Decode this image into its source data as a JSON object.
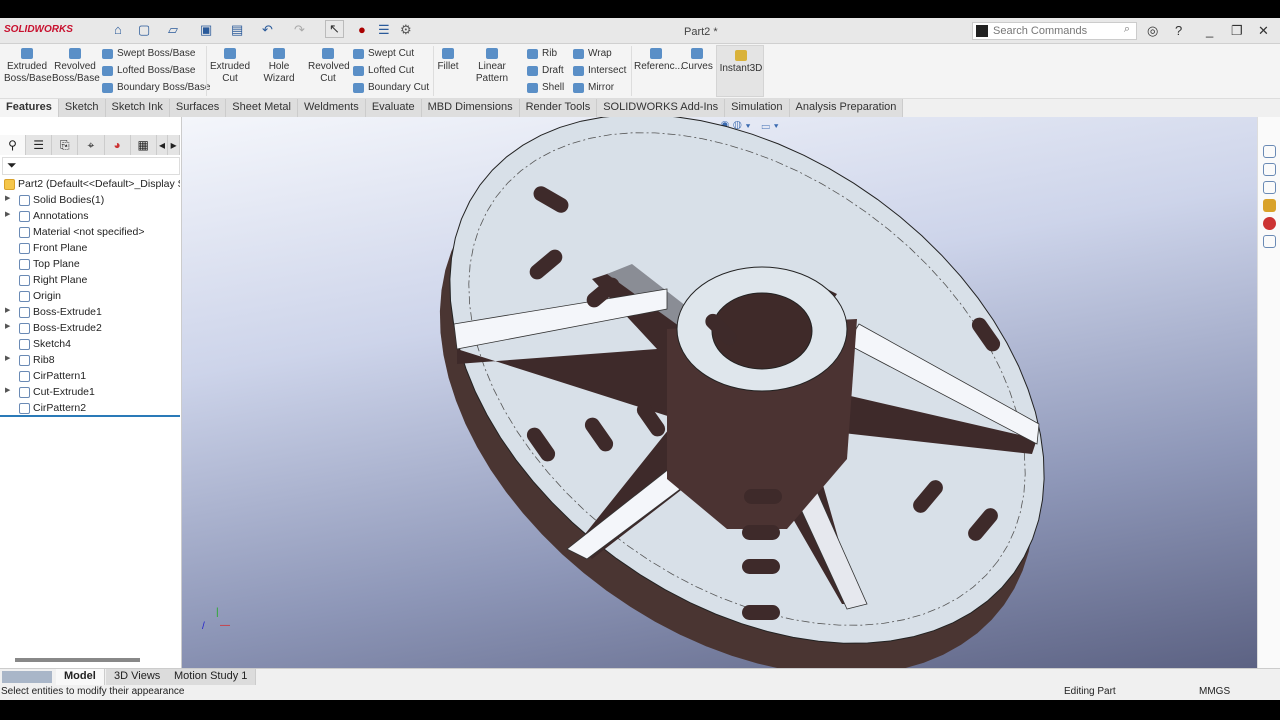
{
  "app": {
    "name": "SOLIDWORKS",
    "document_title": "Part2 *"
  },
  "search": {
    "placeholder": "Search Commands"
  },
  "ribbon": {
    "extruded_boss": "Extruded Boss/Base",
    "revolved_boss": "Revolved Boss/Base",
    "swept_boss": "Swept Boss/Base",
    "lofted_boss": "Lofted Boss/Base",
    "boundary_boss": "Boundary Boss/Base",
    "extruded_cut": "Extruded Cut",
    "hole_wizard": "Hole Wizard",
    "revolved_cut": "Revolved Cut",
    "swept_cut": "Swept Cut",
    "lofted_cut": "Lofted Cut",
    "boundary_cut": "Boundary Cut",
    "fillet": "Fillet",
    "linear_pattern": "Linear Pattern",
    "rib": "Rib",
    "draft": "Draft",
    "shell": "Shell",
    "wrap": "Wrap",
    "intersect": "Intersect",
    "mirror": "Mirror",
    "reference": "Referenc...",
    "curves": "Curves",
    "instant3d": "Instant3D"
  },
  "tabs": [
    "Features",
    "Sketch",
    "Sketch Ink",
    "Surfaces",
    "Sheet Metal",
    "Weldments",
    "Evaluate",
    "MBD Dimensions",
    "Render Tools",
    "SOLIDWORKS Add-Ins",
    "Simulation",
    "Analysis Preparation"
  ],
  "tree": {
    "root": "Part2  (Default<<Default>_Display S",
    "items": [
      {
        "label": "Solid Bodies(1)",
        "expandable": true
      },
      {
        "label": "Annotations",
        "expandable": true
      },
      {
        "label": "Material <not specified>",
        "expandable": false
      },
      {
        "label": "Front Plane",
        "expandable": false
      },
      {
        "label": "Top Plane",
        "expandable": false
      },
      {
        "label": "Right Plane",
        "expandable": false
      },
      {
        "label": "Origin",
        "expandable": false
      },
      {
        "label": "Boss-Extrude1",
        "expandable": true
      },
      {
        "label": "Boss-Extrude2",
        "expandable": true
      },
      {
        "label": "Sketch4",
        "expandable": false
      },
      {
        "label": "Rib8",
        "expandable": true
      },
      {
        "label": "CirPattern1",
        "expandable": false
      },
      {
        "label": "Cut-Extrude1",
        "expandable": true
      },
      {
        "label": "CirPattern2",
        "expandable": false
      }
    ]
  },
  "bottom_tabs": [
    "Model",
    "3D Views",
    "Motion Study 1"
  ],
  "status": {
    "message": "Select entities to modify their appearance",
    "mode": "Editing Part",
    "units": "MMGS"
  }
}
